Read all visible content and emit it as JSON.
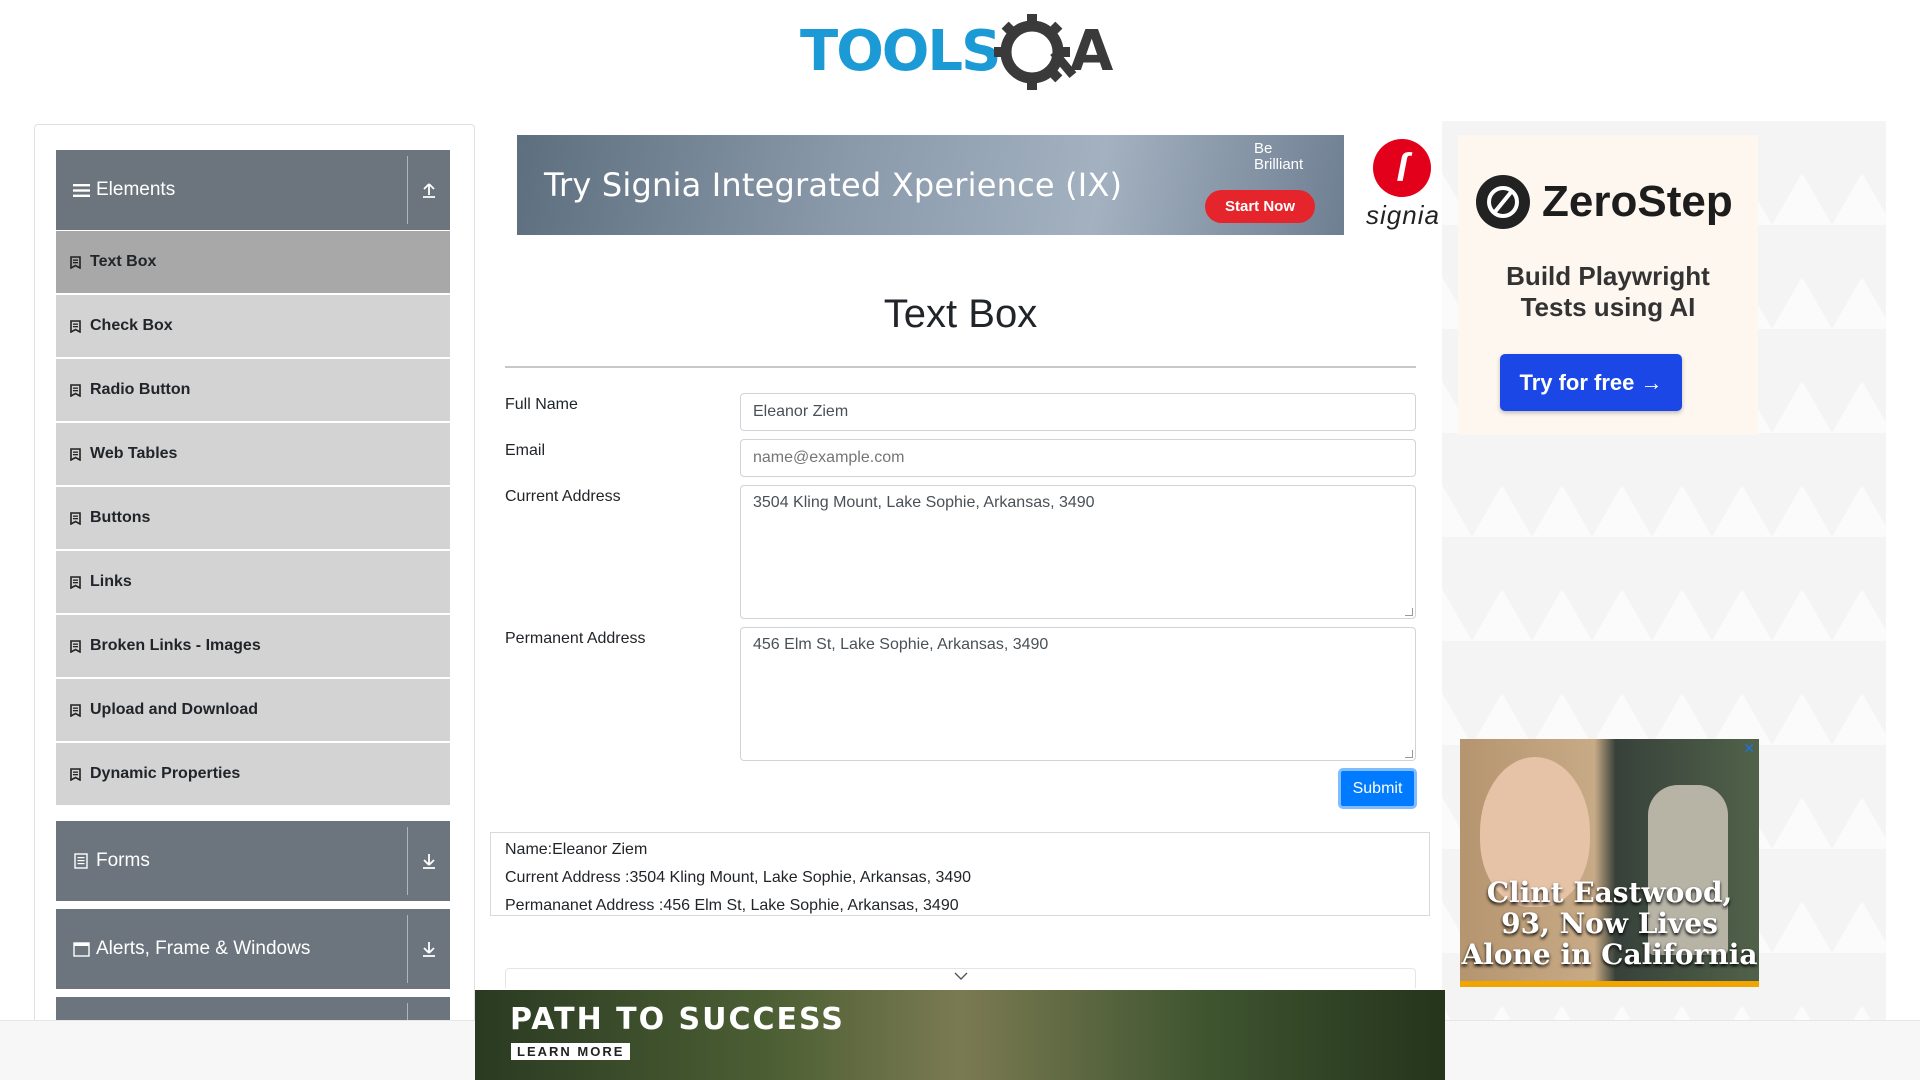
{
  "brand": {
    "logo_text": "TOOLSQA"
  },
  "sidebar": {
    "groups": [
      {
        "title": "Elements",
        "items": [
          {
            "label": "Text Box"
          },
          {
            "label": "Check Box"
          },
          {
            "label": "Radio Button"
          },
          {
            "label": "Web Tables"
          },
          {
            "label": "Buttons"
          },
          {
            "label": "Links"
          },
          {
            "label": "Broken Links - Images"
          },
          {
            "label": "Upload and Download"
          },
          {
            "label": "Dynamic Properties"
          }
        ]
      },
      {
        "title": "Forms"
      },
      {
        "title": "Alerts, Frame & Windows"
      }
    ],
    "active_item": "Text Box"
  },
  "main": {
    "title": "Text Box",
    "form": {
      "full_name": {
        "label": "Full Name",
        "value": "Eleanor Ziem"
      },
      "email": {
        "label": "Email",
        "placeholder": "name@example.com",
        "value": ""
      },
      "current_address": {
        "label": "Current Address",
        "value": "3504 Kling Mount, Lake Sophie, Arkansas, 3490"
      },
      "permanent_address": {
        "label": "Permanent Address",
        "value": "456 Elm St, Lake Sophie, Arkansas, 3490"
      },
      "submit_label": "Submit"
    },
    "output": {
      "name": "Name:Eleanor Ziem",
      "current_address": "Current Address :3504 Kling Mount, Lake Sophie, Arkansas, 3490",
      "permanent_address": "Permananet Address :456 Elm St, Lake Sophie, Arkansas, 3490"
    }
  },
  "ads": {
    "top_banner": {
      "headline": "Try Signia Integrated Xperience (IX)",
      "tagline": "Be Brilliant",
      "cta": "Start Now",
      "brand": "signia"
    },
    "zerostep": {
      "brand": "ZeroStep",
      "tagline": "Build Playwright Tests using AI",
      "cta": "Try for free →"
    },
    "clint": {
      "headline": "Clint Eastwood, 93, Now Lives Alone in California",
      "close": "✕"
    },
    "bottom_banner": {
      "headline": "PATH TO SUCCESS",
      "cta": "LEARN MORE"
    }
  },
  "colors": {
    "brand_blue": "#1c9ad6",
    "brand_dark": "#3a3a3a",
    "sidebar_header": "#6c757d",
    "menu_item": "#d3d3d3",
    "menu_item_active": "#a8a8a8",
    "submit": "#007bff"
  },
  "icons": {
    "elements_group": "hamburger-icon",
    "group_expanded": "collapse-arrow-icon",
    "group_collapsed": "expand-arrow-icon",
    "menu_item": "bookmark-icon",
    "forms_group": "document-icon",
    "alerts_group": "window-icon"
  }
}
